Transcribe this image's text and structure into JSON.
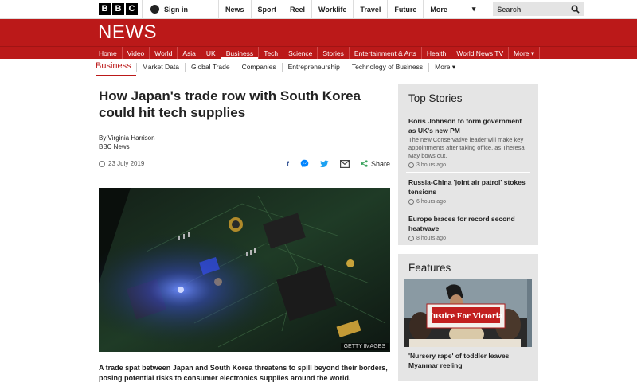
{
  "topbar": {
    "logo_letters": [
      "B",
      "B",
      "C"
    ],
    "signin": "Sign in",
    "nav": [
      "News",
      "Sport",
      "Reel",
      "Worklife",
      "Travel",
      "Future"
    ],
    "more": "More",
    "search_placeholder": "Search"
  },
  "banner": {
    "title": "NEWS"
  },
  "section_nav": [
    "Home",
    "Video",
    "World",
    "Asia",
    "UK",
    "Business",
    "Tech",
    "Science",
    "Stories",
    "Entertainment & Arts",
    "Health",
    "World News TV",
    "More ▾"
  ],
  "section_active": "Business",
  "sub_nav": {
    "current": "Business",
    "items": [
      "Market Data",
      "Global Trade",
      "Companies",
      "Entrepreneurship",
      "Technology of Business",
      "More ▾"
    ]
  },
  "article": {
    "headline": "How Japan's trade row with South Korea could hit tech supplies",
    "author": "By Virginia Harrison",
    "outlet": "BBC News",
    "date": "23 July 2019",
    "share_label": "Share",
    "image_credit": "GETTY IMAGES",
    "summary": "A trade spat between Japan and South Korea threatens to spill beyond their borders, posing potential risks to consumer electronics supplies around the world."
  },
  "top_stories": {
    "heading": "Top Stories",
    "items": [
      {
        "title": "Boris Johnson to form government as UK's new PM",
        "desc": "The new Conservative leader will make key appointments after taking office, as Theresa May bows out.",
        "ago": "3 hours ago"
      },
      {
        "title": "Russia-China 'joint air patrol' stokes tensions",
        "desc": "",
        "ago": "6 hours ago"
      },
      {
        "title": "Europe braces for record second heatwave",
        "desc": "",
        "ago": "8 hours ago"
      }
    ]
  },
  "features": {
    "heading": "Features",
    "sign_text": "Justice For Victoria",
    "item_title": "'Nursery rape' of toddler leaves Myanmar reeling"
  },
  "colors": {
    "brand_red": "#bb1919",
    "panel_grey": "#e5e5e5"
  }
}
